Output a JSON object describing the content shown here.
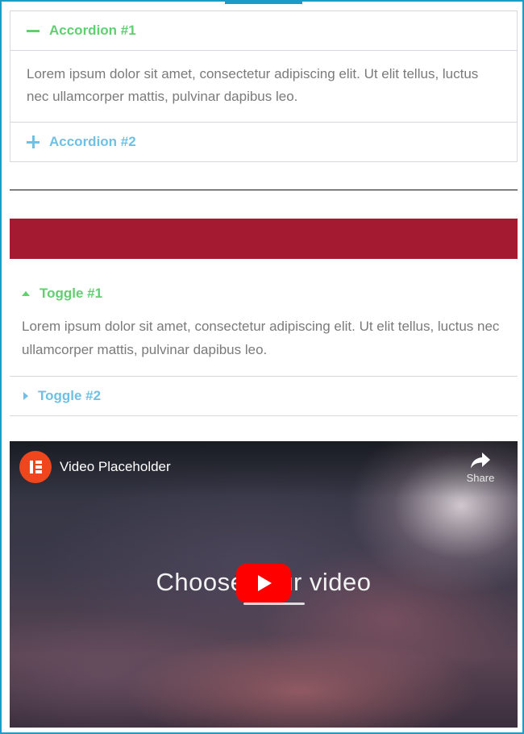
{
  "accordion": {
    "items": [
      {
        "title": "Accordion #1",
        "content": "Lorem ipsum dolor sit amet, consectetur adipiscing elit. Ut elit tellus, luctus nec ullamcorper mattis, pulvinar dapibus leo."
      },
      {
        "title": "Accordion #2"
      }
    ]
  },
  "toggle": {
    "items": [
      {
        "title": "Toggle #1",
        "content": "Lorem ipsum dolor sit amet, consectetur adipiscing elit. Ut elit tellus, luctus nec ullamcorper mattis, pulvinar dapibus leo."
      },
      {
        "title": "Toggle #2"
      }
    ]
  },
  "video": {
    "title": "Video Placeholder",
    "share_label": "Share",
    "center_text": "Choose your video"
  },
  "colors": {
    "frame": "#1a9cc7",
    "active_title": "#61ce70",
    "inactive_title": "#6ec1e4",
    "banner": "#a31a31",
    "play_button": "#ff0000"
  }
}
